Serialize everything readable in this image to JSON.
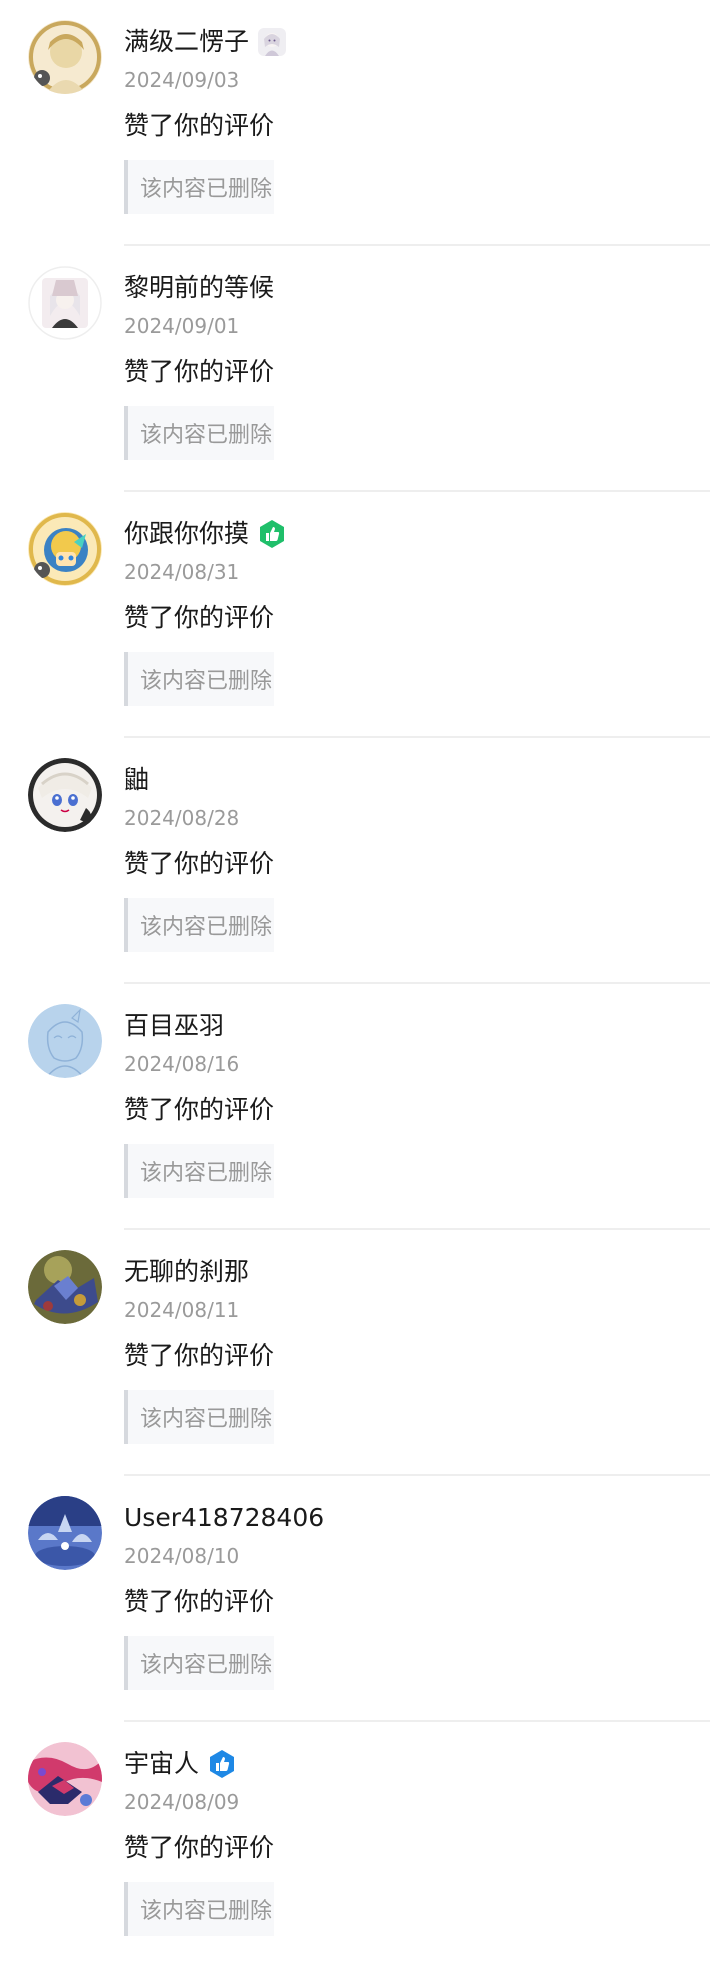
{
  "notifications": [
    {
      "user": "满级二愣子",
      "badge": "character-avatar-badge",
      "date": "2024/09/03",
      "action": "赞了你的评价",
      "quote": "该内容已删除",
      "avatar_colors": [
        "#e9d7a6",
        "#c9a85d",
        "#f6ead0"
      ]
    },
    {
      "user": "黎明前的等候",
      "badge": "",
      "date": "2024/09/01",
      "action": "赞了你的评价",
      "quote": "该内容已删除",
      "avatar_colors": [
        "#f3ecef",
        "#d9c9d0",
        "#3a3a3a"
      ]
    },
    {
      "user": "你跟你你摸",
      "badge": "green-thumb-badge",
      "date": "2024/08/31",
      "action": "赞了你的评价",
      "quote": "该内容已删除",
      "avatar_colors": [
        "#f2c94c",
        "#3b82c4",
        "#9b5de5"
      ]
    },
    {
      "user": "鼬",
      "badge": "",
      "date": "2024/08/28",
      "action": "赞了你的评价",
      "quote": "该内容已删除",
      "avatar_colors": [
        "#f4f1ee",
        "#2b2b2b",
        "#4a6fd1"
      ]
    },
    {
      "user": "百目巫羽",
      "badge": "",
      "date": "2024/08/16",
      "action": "赞了你的评价",
      "quote": "该内容已删除",
      "avatar_colors": [
        "#b8d3ec",
        "#8fb2d8",
        "#e8f1fa"
      ]
    },
    {
      "user": "无聊的刹那",
      "badge": "",
      "date": "2024/08/11",
      "action": "赞了你的评价",
      "quote": "该内容已删除",
      "avatar_colors": [
        "#6b6a3a",
        "#3d4b8c",
        "#c59b3a"
      ]
    },
    {
      "user": "User418728406",
      "badge": "",
      "date": "2024/08/10",
      "action": "赞了你的评价",
      "quote": "该内容已删除",
      "avatar_colors": [
        "#5a78c9",
        "#2a3f86",
        "#c8d6f2"
      ]
    },
    {
      "user": "宇宙人",
      "badge": "blue-thumb-badge",
      "date": "2024/08/09",
      "action": "赞了你的评价",
      "quote": "该内容已删除",
      "avatar_colors": [
        "#d13a6c",
        "#2b2b6b",
        "#f2c2d2"
      ]
    }
  ],
  "colors": {
    "name_text": "#1a1a1a",
    "date_text": "#9a9a9a",
    "quote_text": "#999999",
    "quote_bar": "#d6d9de",
    "divider": "#eeeeee",
    "green_badge": "#1fbf6a",
    "blue_badge": "#1e88e5"
  }
}
